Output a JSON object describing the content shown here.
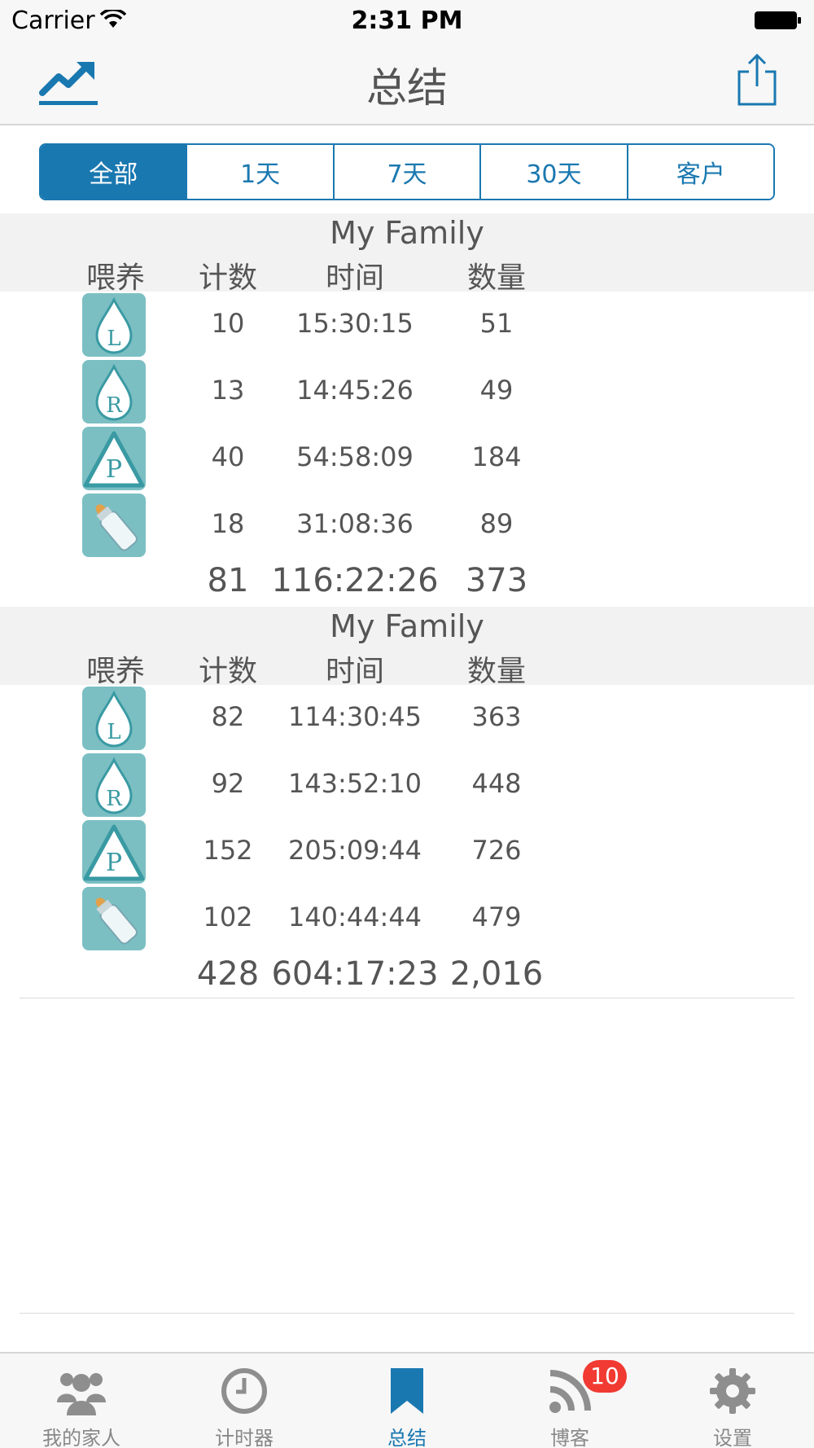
{
  "status_bar": {
    "carrier": "Carrier",
    "time": "2:31 PM"
  },
  "nav": {
    "title": "总结",
    "left_icon": "trend-chart-icon",
    "right_icon": "share-icon"
  },
  "segments": [
    {
      "label": "全部",
      "active": true
    },
    {
      "label": "1天",
      "active": false
    },
    {
      "label": "7天",
      "active": false
    },
    {
      "label": "30天",
      "active": false
    },
    {
      "label": "客户",
      "active": false
    }
  ],
  "columns": {
    "feed": "喂养",
    "count": "计数",
    "time": "时间",
    "qty": "数量"
  },
  "sections": [
    {
      "title": "My Family",
      "rows": [
        {
          "icon": "left-breast-icon",
          "letter": "L",
          "count": "10",
          "time": "15:30:15",
          "qty": "51"
        },
        {
          "icon": "right-breast-icon",
          "letter": "R",
          "count": "13",
          "time": "14:45:26",
          "qty": "49"
        },
        {
          "icon": "pump-icon",
          "letter": "P",
          "count": "40",
          "time": "54:58:09",
          "qty": "184"
        },
        {
          "icon": "bottle-icon",
          "letter": "",
          "count": "18",
          "time": "31:08:36",
          "qty": "89"
        }
      ],
      "total": {
        "count": "81",
        "time": "116:22:26",
        "qty": "373"
      }
    },
    {
      "title": "My Family",
      "rows": [
        {
          "icon": "left-breast-icon",
          "letter": "L",
          "count": "82",
          "time": "114:30:45",
          "qty": "363"
        },
        {
          "icon": "right-breast-icon",
          "letter": "R",
          "count": "92",
          "time": "143:52:10",
          "qty": "448"
        },
        {
          "icon": "pump-icon",
          "letter": "P",
          "count": "152",
          "time": "205:09:44",
          "qty": "726"
        },
        {
          "icon": "bottle-icon",
          "letter": "",
          "count": "102",
          "time": "140:44:44",
          "qty": "479"
        }
      ],
      "total": {
        "count": "428",
        "time": "604:17:23",
        "qty": "2,016"
      }
    }
  ],
  "tabs": [
    {
      "label": "我的家人",
      "icon": "family-icon",
      "active": false
    },
    {
      "label": "计时器",
      "icon": "clock-icon",
      "active": false
    },
    {
      "label": "总结",
      "icon": "bookmark-icon",
      "active": true
    },
    {
      "label": "博客",
      "icon": "rss-icon",
      "active": false,
      "badge": "10"
    },
    {
      "label": "设置",
      "icon": "gear-icon",
      "active": false
    }
  ],
  "colors": {
    "accent": "#1a78b0",
    "icon_bg": "#7bbfc3",
    "badge": "#f13a32"
  }
}
